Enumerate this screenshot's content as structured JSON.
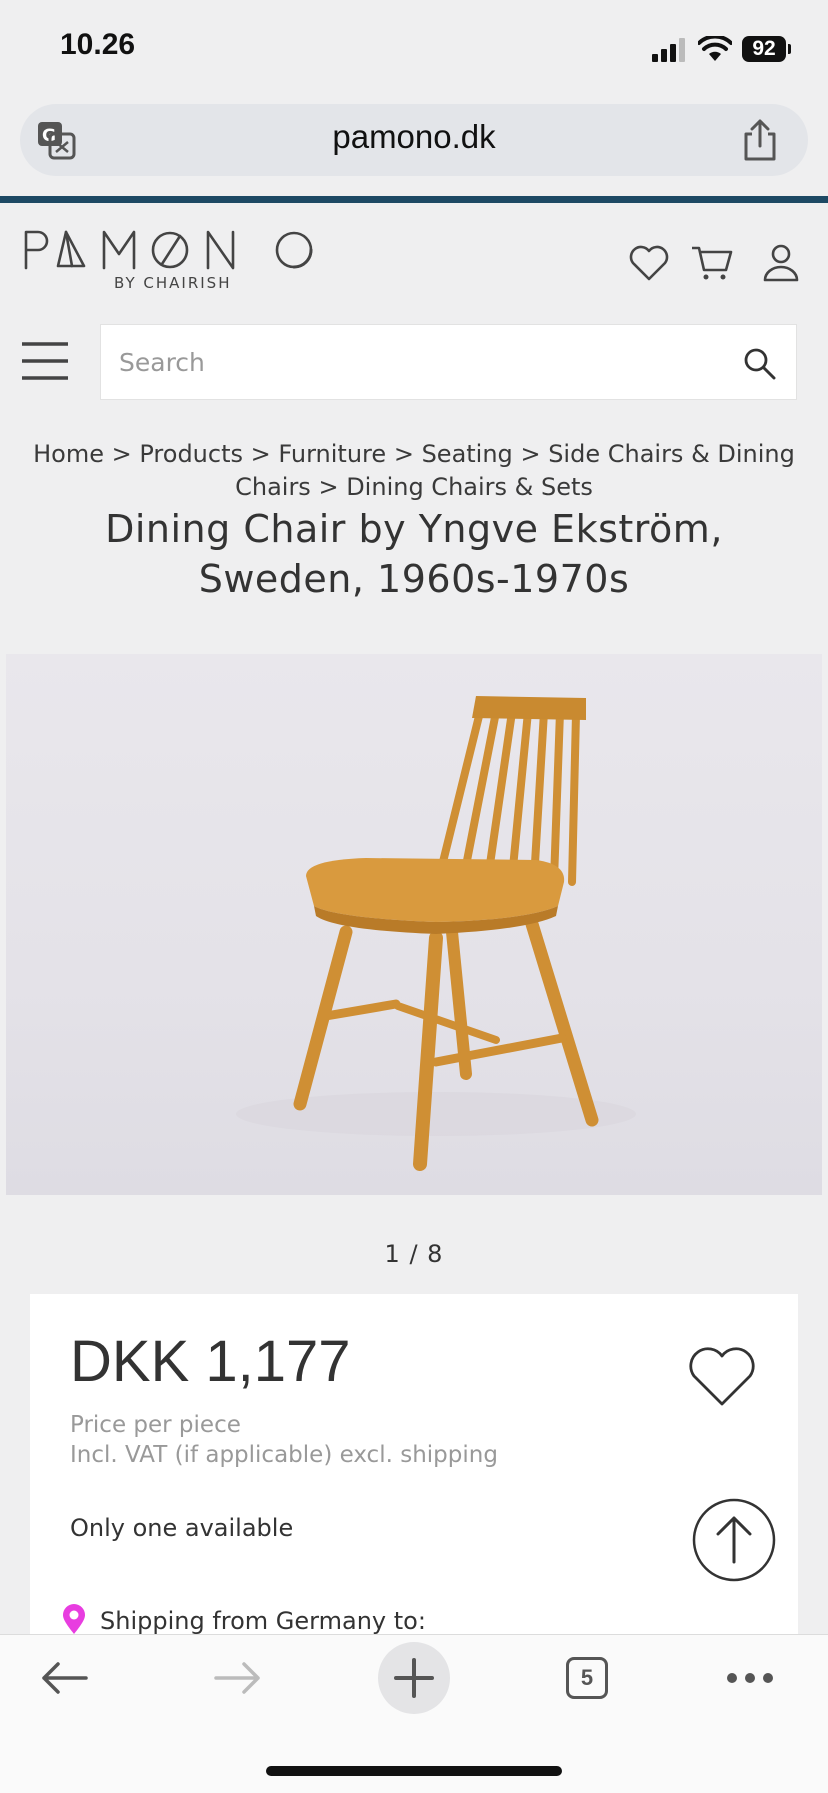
{
  "status_bar": {
    "time": "10.26",
    "battery": "92",
    "icons": [
      "cellular-signal-icon",
      "wifi-icon",
      "battery-icon"
    ]
  },
  "browser": {
    "url": "pamono.dk",
    "translate_icon": "translate-icon",
    "share_icon": "share-icon",
    "tab_count": "5"
  },
  "header": {
    "logo_text": "PAMONO",
    "logo_subtitle": "BY CHAIRISH",
    "icons": [
      "heart-icon",
      "cart-icon",
      "user-icon"
    ]
  },
  "search": {
    "placeholder": "Search"
  },
  "breadcrumb": {
    "items": [
      "Home",
      "Products",
      "Furniture",
      "Seating",
      "Side Chairs & Dining Chairs",
      "Dining Chairs & Sets"
    ],
    "separator": ">"
  },
  "product": {
    "title": "Dining Chair by Yngve Ekström, Sweden, 1960s-1970s",
    "image_counter": "1 / 8",
    "price": "DKK 1,177",
    "price_note": "Price per piece",
    "vat_note": "Incl. VAT (if applicable) excl. shipping",
    "availability": "Only one available",
    "shipping": "Shipping from Germany to:"
  },
  "colors": {
    "accent_bar": "#1d4964",
    "location_pin": "#e83de0",
    "background": "#efeff0"
  }
}
